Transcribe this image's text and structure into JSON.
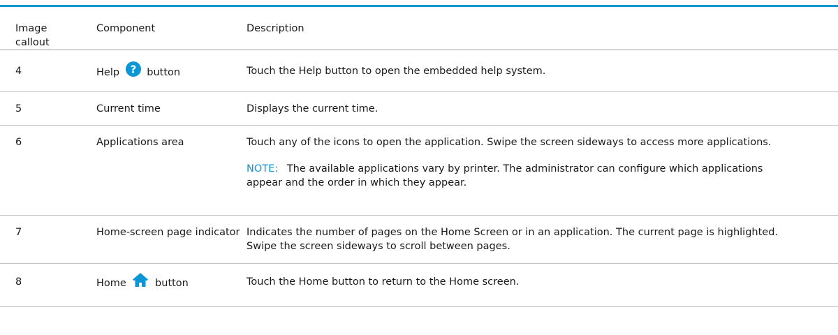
{
  "table": {
    "headers": {
      "image_callout": "Image callout",
      "component": "Component",
      "description": "Description"
    },
    "rows": [
      {
        "callout": "4",
        "component_before": "Help",
        "component_icon": "question-mark-circle-icon",
        "component_after": "button",
        "description": "Touch the Help button to open the embedded help system."
      },
      {
        "callout": "5",
        "component": "Current time",
        "description": "Displays the current time."
      },
      {
        "callout": "6",
        "component": "Applications area",
        "description": "Touch any of the icons to open the application. Swipe the screen sideways to access more applications.",
        "note_label": "NOTE:",
        "note_text": "The available applications vary by printer. The administrator can configure which applications appear and the order in which they appear."
      },
      {
        "callout": "7",
        "component": "Home-screen page indicator",
        "description": "Indicates the number of pages on the Home Screen or in an application. The current page is highlighted. Swipe the screen sideways to scroll between pages."
      },
      {
        "callout": "8",
        "component_before": "Home",
        "component_icon": "home-icon",
        "component_after": "button",
        "description": "Touch the Home button to return to the Home screen."
      }
    ]
  },
  "colors": {
    "accent": "#0b96d6",
    "text": "#1a1a1a",
    "rule": "#c4c4c4"
  }
}
